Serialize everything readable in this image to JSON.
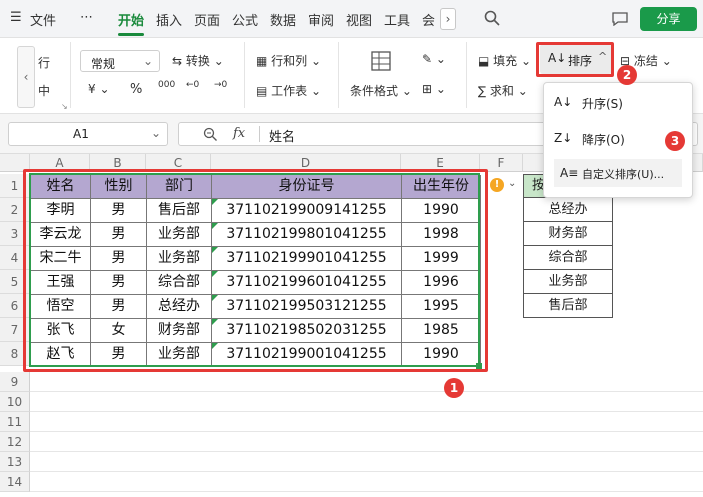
{
  "menubar": {
    "hamburger": "☰",
    "file": "文件",
    "more": "⋯",
    "tabs": [
      "开始",
      "插入",
      "页面",
      "公式",
      "数据",
      "审阅",
      "视图",
      "工具",
      "会"
    ],
    "share": "分享"
  },
  "ribbon": {
    "partial_top": "行",
    "partial_bottom": "中",
    "number_format": "常规",
    "convert": "转换",
    "currency": "¥",
    "percent": "%",
    "thousands": "000",
    "inc_decimal": "←0",
    "dec_decimal": "→0",
    "rows_cols": "行和列",
    "worksheet": "工作表",
    "cond_format": "条件格式",
    "fill": "填充",
    "sort": "排序",
    "freeze": "冻结",
    "sum": "求和"
  },
  "formula_bar": {
    "cell_ref": "A1",
    "fx": "fx",
    "content": "姓名"
  },
  "columns": [
    "A",
    "B",
    "C",
    "D",
    "E",
    "F"
  ],
  "rows": [
    "1",
    "2",
    "3",
    "4",
    "5",
    "6",
    "7",
    "8",
    "9",
    "10",
    "11",
    "12",
    "13",
    "14"
  ],
  "table": {
    "headers": [
      "姓名",
      "性别",
      "部门",
      "身份证号",
      "出生年份"
    ],
    "rows": [
      [
        "李明",
        "男",
        "售后部",
        "371102199009141255",
        "1990"
      ],
      [
        "李云龙",
        "男",
        "业务部",
        "371102199801041255",
        "1998"
      ],
      [
        "宋二牛",
        "男",
        "业务部",
        "371102199901041255",
        "1999"
      ],
      [
        "王强",
        "男",
        "综合部",
        "371102199601041255",
        "1996"
      ],
      [
        "悟空",
        "男",
        "总经办",
        "371102199503121255",
        "1995"
      ],
      [
        "张飞",
        "女",
        "财务部",
        "371102198502031255",
        "1985"
      ],
      [
        "赵飞",
        "男",
        "业务部",
        "371102199001041255",
        "1990"
      ]
    ]
  },
  "side_column": {
    "header": "按",
    "items": [
      "总经办",
      "财务部",
      "综合部",
      "业务部",
      "售后部"
    ]
  },
  "dropdown": {
    "asc": "升序(S)",
    "desc": "降序(O)",
    "custom": "自定义排序(U)..."
  },
  "badges": [
    "1",
    "2",
    "3"
  ],
  "colors": {
    "accent": "#1a8a3c",
    "header_fill": "#b4a7d0",
    "highlight": "#e53935"
  }
}
